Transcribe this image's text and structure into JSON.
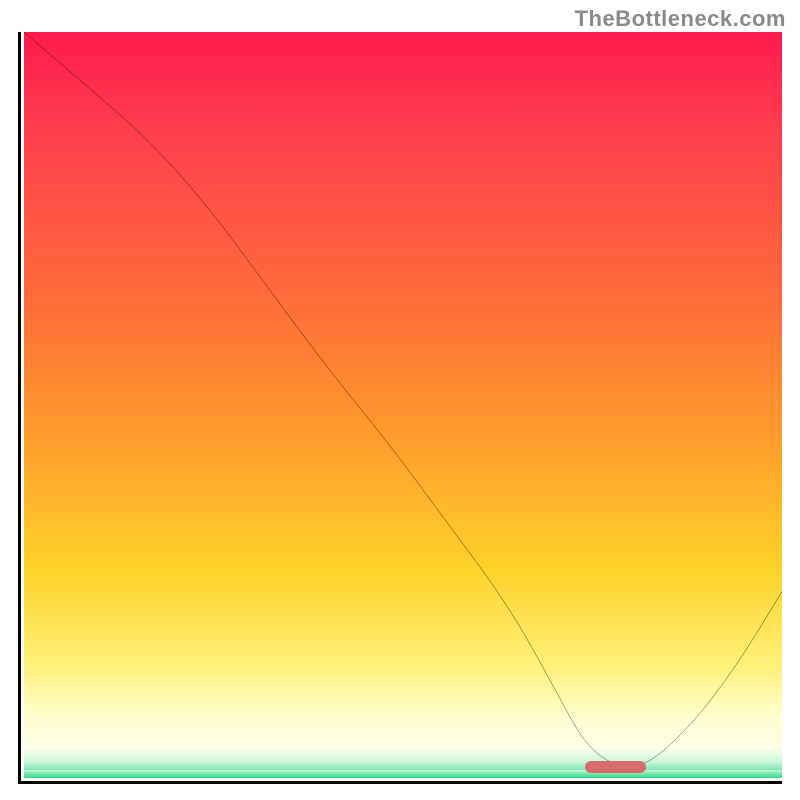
{
  "watermark_text": "TheBottleneck.com",
  "chart_data": {
    "type": "line",
    "title": "",
    "xlabel": "",
    "ylabel": "",
    "xlim": [
      0,
      100
    ],
    "ylim": [
      0,
      100
    ],
    "grid": false,
    "legend": false,
    "series": [
      {
        "name": "bottleneck-curve",
        "x": [
          0,
          8,
          16,
          24,
          32,
          40,
          48,
          56,
          64,
          70,
          74,
          78,
          82,
          88,
          94,
          100
        ],
        "values": [
          100,
          93,
          86,
          77,
          66,
          55,
          45,
          34,
          23,
          12,
          4.5,
          1.5,
          1.5,
          7,
          15,
          25
        ]
      }
    ],
    "optimal_marker": {
      "x_start": 74,
      "x_end": 82,
      "y": 1.5,
      "color": "#d66a6d"
    },
    "background_gradient": {
      "stops": [
        {
          "pos": 0.0,
          "color": "#ff1a4d"
        },
        {
          "pos": 0.35,
          "color": "#ff6a3a"
        },
        {
          "pos": 0.6,
          "color": "#ffc529"
        },
        {
          "pos": 0.85,
          "color": "#fff07a"
        },
        {
          "pos": 0.96,
          "color": "#d8f9d0"
        },
        {
          "pos": 1.0,
          "color": "#2fdc8c"
        }
      ]
    }
  }
}
